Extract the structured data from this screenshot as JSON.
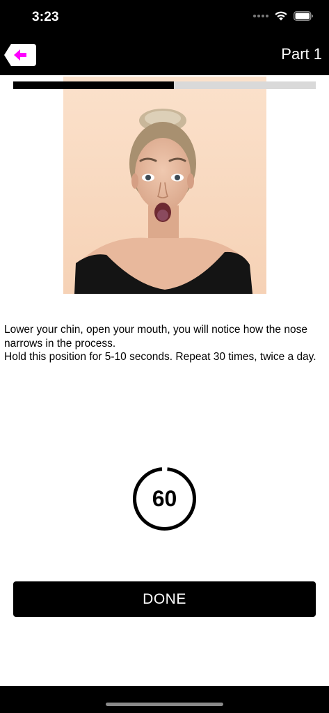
{
  "status_bar": {
    "time": "3:23",
    "signal_icon": "signal-dots-icon",
    "wifi_icon": "wifi-icon",
    "battery_icon": "battery-icon"
  },
  "nav": {
    "back_icon": "arrow-left-icon",
    "title": "Part 1",
    "accent_color": "#ff00ff"
  },
  "progress": {
    "percent": 53
  },
  "exercise": {
    "image": "woman-open-mouth-photo",
    "instruction_lines": [
      "Lower your chin, open your mouth, you will notice how the nose narrows in the process.",
      "Hold this position for 5-10 seconds. Repeat 30 times, twice a day."
    ]
  },
  "timer": {
    "value": "60",
    "remaining_fraction": 0.97
  },
  "done_button": {
    "label": "DONE"
  }
}
